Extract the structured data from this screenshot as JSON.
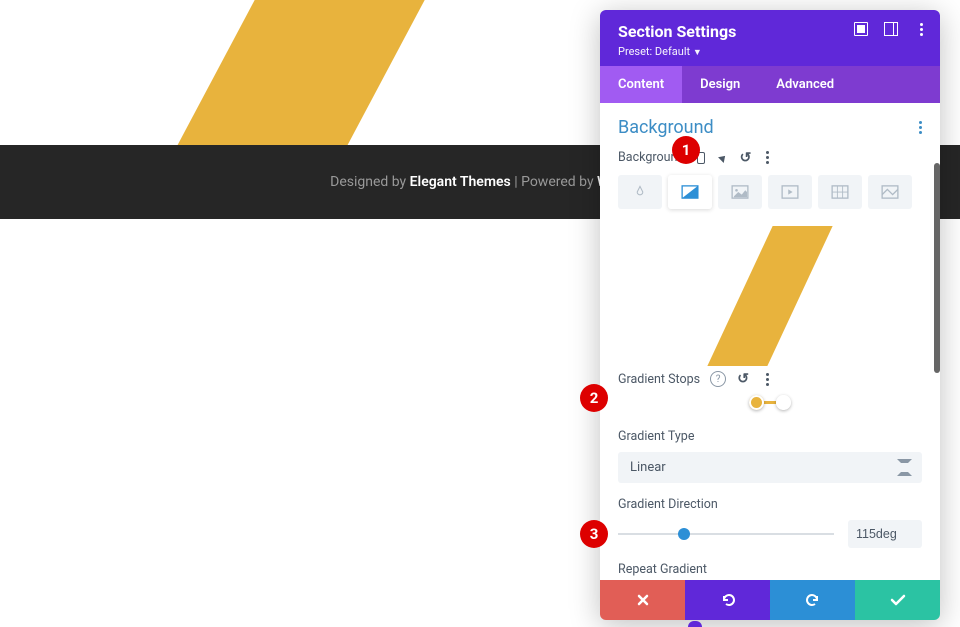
{
  "footer": {
    "designed_by": "Designed by ",
    "theme": "Elegant Themes",
    "powered_by": " | Powered by ",
    "platform": "Word"
  },
  "panel": {
    "title": "Section Settings",
    "preset": "Preset: Default",
    "tabs": {
      "content": "Content",
      "design": "Design",
      "advanced": "Advanced"
    },
    "background": {
      "title": "Background",
      "label": "Background"
    },
    "gradient_stops": {
      "label": "Gradient Stops"
    },
    "gradient_type": {
      "label": "Gradient Type",
      "value": "Linear"
    },
    "gradient_direction": {
      "label": "Gradient Direction",
      "value": "115deg"
    },
    "repeat_gradient": {
      "label": "Repeat Gradient"
    }
  },
  "annotations": {
    "a1": "1",
    "a2": "2",
    "a3": "3"
  },
  "chart_data": {
    "type": "gradient-settings",
    "stops": [
      {
        "color": "#e8b33d",
        "position": 50
      },
      {
        "color": "#ffffff",
        "position": 60
      }
    ],
    "gradient_type": "Linear",
    "direction_deg": 115,
    "direction_range": [
      0,
      360
    ]
  }
}
